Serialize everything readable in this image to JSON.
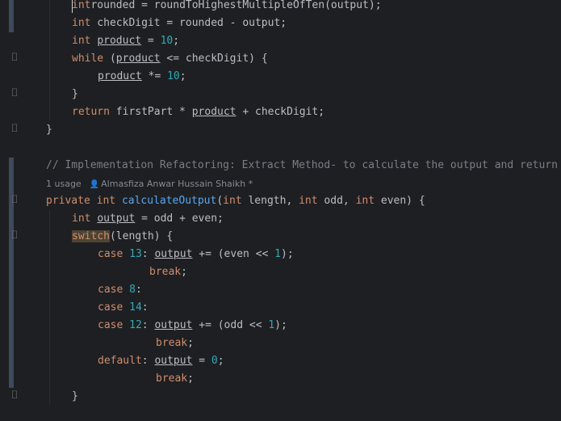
{
  "editor": {
    "lines": [
      {
        "id": "l1",
        "tokens": [
          [
            "kw",
            "int"
          ],
          [
            "",
            "rounded = "
          ],
          [
            "",
            "roundToHighestMultipleOfTen(output);"
          ]
        ]
      },
      {
        "id": "l2",
        "tokens": [
          [
            "kw",
            "int"
          ],
          [
            "",
            " checkDigit = rounded - output;"
          ]
        ]
      },
      {
        "id": "l3",
        "tokens": [
          [
            "kw",
            "int"
          ],
          [
            "",
            " "
          ],
          [
            "var",
            "product"
          ],
          [
            "",
            " = "
          ],
          [
            "num",
            "10"
          ],
          [
            "",
            ";"
          ]
        ]
      },
      {
        "id": "l4",
        "tokens": [
          [
            "kw",
            "while"
          ],
          [
            "",
            " ("
          ],
          [
            "var",
            "product"
          ],
          [
            "",
            " <= checkDigit) {"
          ]
        ]
      },
      {
        "id": "l5",
        "tokens": [
          [
            "var",
            "product"
          ],
          [
            "",
            " *= "
          ],
          [
            "num",
            "10"
          ],
          [
            "",
            ";"
          ]
        ]
      },
      {
        "id": "l6",
        "tokens": [
          [
            "",
            "}"
          ]
        ]
      },
      {
        "id": "l7",
        "tokens": [
          [
            "kw",
            "return"
          ],
          [
            "",
            " firstPart * "
          ],
          [
            "var",
            "product"
          ],
          [
            "",
            " + checkDigit;"
          ]
        ]
      },
      {
        "id": "l8",
        "tokens": [
          [
            "",
            "}"
          ]
        ]
      },
      {
        "id": "l9",
        "tokens": [
          [
            "cm",
            "// Implementation Refactoring: Extract Method- to calculate the output and return"
          ]
        ]
      },
      {
        "id": "l10",
        "tokens": [
          [
            "kw",
            "private"
          ],
          [
            "",
            " "
          ],
          [
            "kw",
            "int"
          ],
          [
            "",
            " "
          ],
          [
            "fn",
            "calculateOutput"
          ],
          [
            "",
            "("
          ],
          [
            "kw",
            "int"
          ],
          [
            "",
            " length, "
          ],
          [
            "kw",
            "int"
          ],
          [
            "",
            " odd, "
          ],
          [
            "kw",
            "int"
          ],
          [
            "",
            " even) {"
          ]
        ]
      },
      {
        "id": "l11",
        "tokens": [
          [
            "kw",
            "int"
          ],
          [
            "",
            " "
          ],
          [
            "var",
            "output"
          ],
          [
            "",
            " = odd + even;"
          ]
        ]
      },
      {
        "id": "l12",
        "tokens": [
          [
            "kw hl-sw",
            "switch"
          ],
          [
            "",
            "(length) {"
          ]
        ]
      },
      {
        "id": "l13",
        "tokens": [
          [
            "kw",
            "case"
          ],
          [
            "",
            " "
          ],
          [
            "num",
            "13"
          ],
          [
            "",
            ": "
          ],
          [
            "var",
            "output"
          ],
          [
            "",
            " += (even << "
          ],
          [
            "num",
            "1"
          ],
          [
            "",
            ");"
          ]
        ]
      },
      {
        "id": "l14",
        "tokens": [
          [
            "kw",
            "break"
          ],
          [
            "",
            ";"
          ]
        ]
      },
      {
        "id": "l15",
        "tokens": [
          [
            "kw",
            "case"
          ],
          [
            "",
            " "
          ],
          [
            "num",
            "8"
          ],
          [
            "",
            ":"
          ]
        ]
      },
      {
        "id": "l16",
        "tokens": [
          [
            "kw",
            "case"
          ],
          [
            "",
            " "
          ],
          [
            "num",
            "14"
          ],
          [
            "",
            ":"
          ]
        ]
      },
      {
        "id": "l17",
        "tokens": [
          [
            "kw",
            "case"
          ],
          [
            "",
            " "
          ],
          [
            "num",
            "12"
          ],
          [
            "",
            ": "
          ],
          [
            "var",
            "output"
          ],
          [
            "",
            " += (odd << "
          ],
          [
            "num",
            "1"
          ],
          [
            "",
            ");"
          ]
        ]
      },
      {
        "id": "l18",
        "tokens": [
          [
            "kw",
            "break"
          ],
          [
            "",
            ";"
          ]
        ]
      },
      {
        "id": "l19",
        "tokens": [
          [
            "kw",
            "default"
          ],
          [
            "",
            ": "
          ],
          [
            "var",
            "output"
          ],
          [
            "",
            " = "
          ],
          [
            "num",
            "0"
          ],
          [
            "",
            ";"
          ]
        ]
      },
      {
        "id": "l20",
        "tokens": [
          [
            "kw",
            "break"
          ],
          [
            "",
            ";"
          ]
        ]
      },
      {
        "id": "l21",
        "tokens": [
          [
            "",
            "}"
          ]
        ]
      }
    ]
  },
  "inlay_hint": {
    "usages": "1 usage",
    "author": "Almasfiza Anwar Hussain Shaikh *"
  },
  "icons": {
    "fold": "fold-icon",
    "author": "person-icon"
  },
  "colors": {
    "background": "#1e1f22",
    "keyword": "#cf8e6d",
    "number": "#2aacb8",
    "function": "#56a8f5",
    "comment": "#7a7e85",
    "text": "#bcbec4"
  }
}
